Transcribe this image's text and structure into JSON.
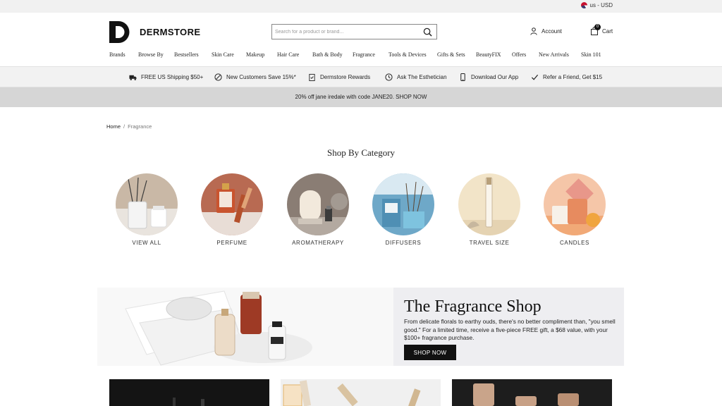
{
  "utility": {
    "locale": "us - USD"
  },
  "header": {
    "logo_text": "DERMSTORE",
    "search_placeholder": "Search for a product or brand...",
    "account_label": "Account",
    "cart_label": "Cart",
    "cart_count": "0"
  },
  "nav": {
    "items": [
      "Brands",
      "Browse By",
      "Bestsellers",
      "Skin Care",
      "Makeup",
      "Hair Care",
      "Bath & Body",
      "Fragrance",
      "Tools & Devices",
      "Gifts & Sets",
      "BeautyFIX",
      "Offers",
      "New Arrivals",
      "Skin 101"
    ]
  },
  "benefits": [
    {
      "label": "FREE US Shipping $50+",
      "icon": "truck-icon"
    },
    {
      "label": "New Customers Save 15%*",
      "icon": "tag-icon"
    },
    {
      "label": "Dermstore Rewards",
      "icon": "clipboard-check-icon"
    },
    {
      "label": "Ask The Esthetician",
      "icon": "clock-icon"
    },
    {
      "label": "Download Our App",
      "icon": "phone-icon"
    },
    {
      "label": "Refer a Friend, Get $15",
      "icon": "check-icon"
    }
  ],
  "promo": {
    "text": "20% off jane iredale with code JANE20. SHOP NOW"
  },
  "breadcrumb": {
    "home": "Home",
    "separator": "/",
    "current": "Fragrance"
  },
  "shop_by_category": {
    "title": "Shop By Category",
    "items": [
      "VIEW ALL",
      "PERFUME",
      "AROMATHERAPY",
      "DIFFUSERS",
      "TRAVEL SIZE",
      "CANDLES"
    ]
  },
  "banner": {
    "title": "The Fragrance Shop",
    "text": "From delicate florals to earthy ouds, there's no better compliment than, \"you smell good.\" For a limited time, receive a five-piece FREE gift, a $68 value, with your $100+ fragrance purchase.",
    "button": "SHOP NOW"
  },
  "colors": {
    "brand": "#111111",
    "bar_grey": "#f2f2f2",
    "promo_grey": "#d6d6d6"
  }
}
